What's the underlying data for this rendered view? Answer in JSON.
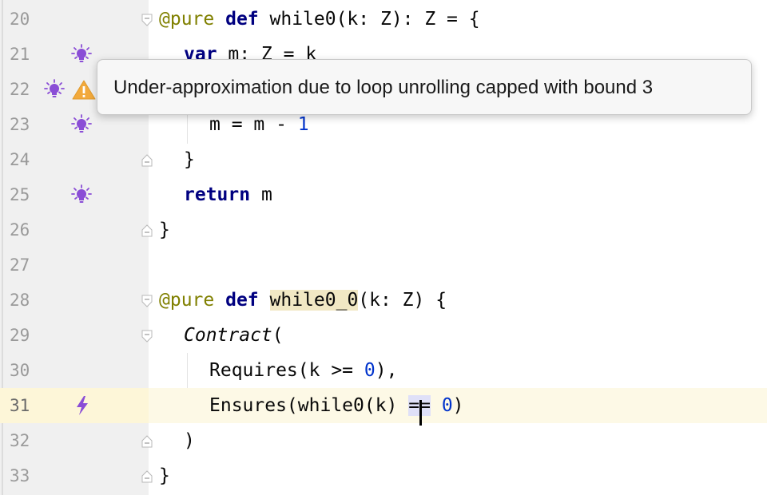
{
  "editor": {
    "lines": [
      {
        "num": "20",
        "text": "@pure def while0(k: Z): Z = {"
      },
      {
        "num": "21",
        "text": "var m: Z = k"
      },
      {
        "num": "22",
        "text": ""
      },
      {
        "num": "23",
        "text": "m = m - 1"
      },
      {
        "num": "24",
        "text": "}"
      },
      {
        "num": "25",
        "text": "return m"
      },
      {
        "num": "26",
        "text": "}"
      },
      {
        "num": "27",
        "text": ""
      },
      {
        "num": "28",
        "text": "@pure def while0_0(k: Z) {"
      },
      {
        "num": "29",
        "text": "Contract("
      },
      {
        "num": "30",
        "text": "Requires(k >= 0),"
      },
      {
        "num": "31",
        "text": "Ensures(while0(k) == 0)"
      },
      {
        "num": "32",
        "text": ")"
      },
      {
        "num": "33",
        "text": "}"
      }
    ],
    "current_line": "31"
  },
  "tooltip": {
    "text": "Under-approximation due to loop unrolling capped with bound 3"
  },
  "colors": {
    "keyword": "#000080",
    "annotation": "#808000",
    "number": "#0033cc",
    "bulb": "#8a4dd6",
    "warning": "#f2a93b",
    "current_line_bg": "#fdf9e6"
  },
  "icons": {
    "line21": "bulb-icon",
    "line22": [
      "bulb-icon",
      "warning-icon"
    ],
    "line23": "bulb-icon",
    "line25": "bulb-icon",
    "line31": "lightning-icon"
  }
}
